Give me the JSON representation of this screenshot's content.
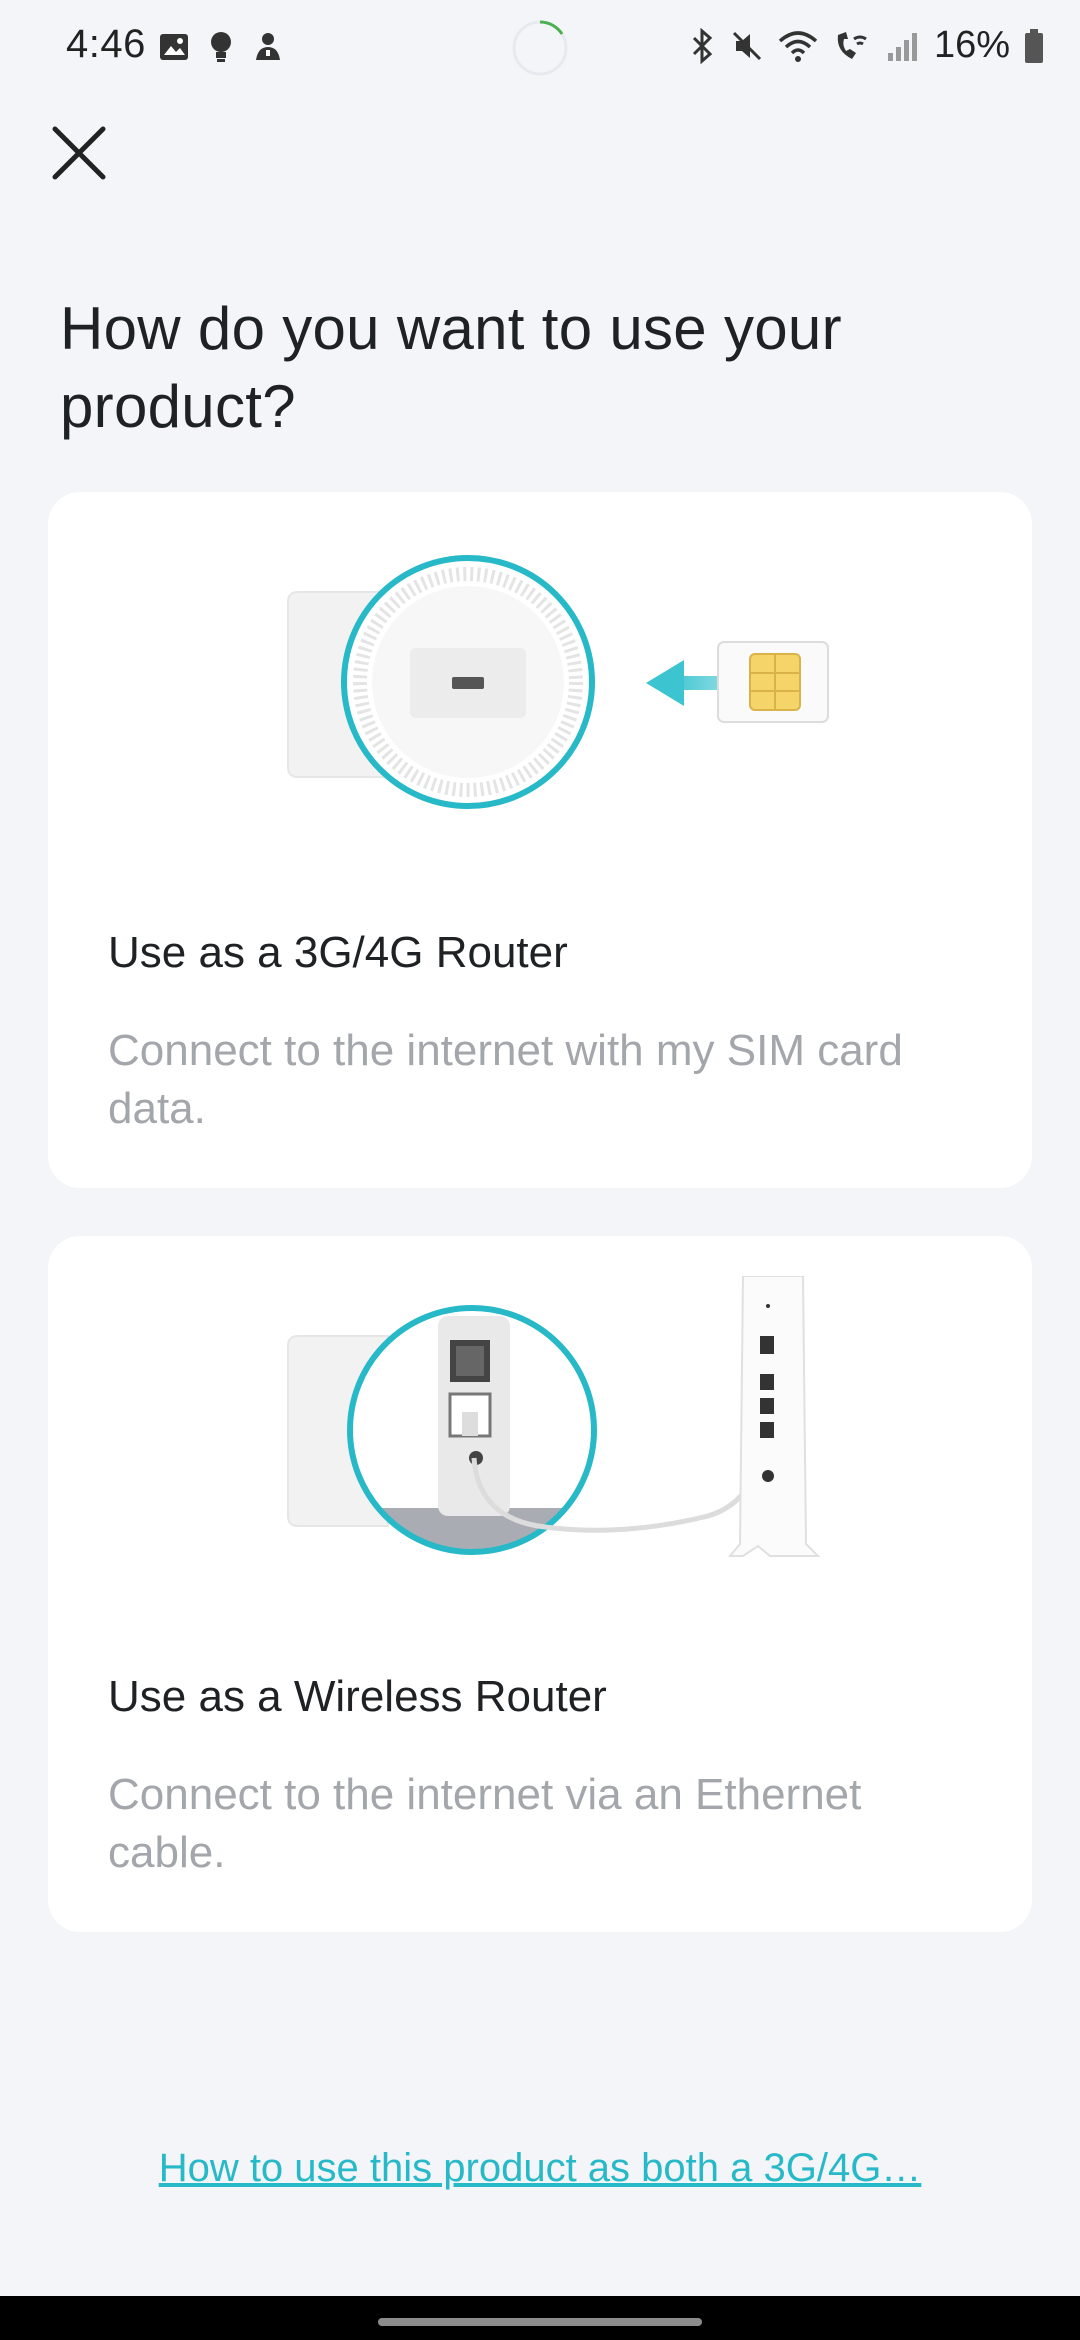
{
  "status_bar": {
    "time": "4:46",
    "battery": "16%",
    "left_icons": [
      "gallery-icon",
      "bulb-icon",
      "user-alert-icon"
    ],
    "right_icons": [
      "bluetooth-icon",
      "mute-icon",
      "wifi-icon",
      "wifi-calling-icon",
      "signal-icon",
      "battery-icon"
    ]
  },
  "header": {
    "close_icon": "close-icon",
    "title": "How do you want to use your product?"
  },
  "options": [
    {
      "title": "Use as a 3G/4G Router",
      "description": "Connect to the internet with my SIM card data.",
      "illustration": "sim-card-insert-illustration"
    },
    {
      "title": "Use as a Wireless Router",
      "description": "Connect to the internet via an Ethernet cable.",
      "illustration": "ethernet-cable-illustration"
    }
  ],
  "help_link": "How to use this product as both a 3G/4G…",
  "colors": {
    "accent": "#27b9c8",
    "background": "#f3f5f9",
    "card": "#ffffff",
    "muted_text": "#a3a6ab"
  }
}
